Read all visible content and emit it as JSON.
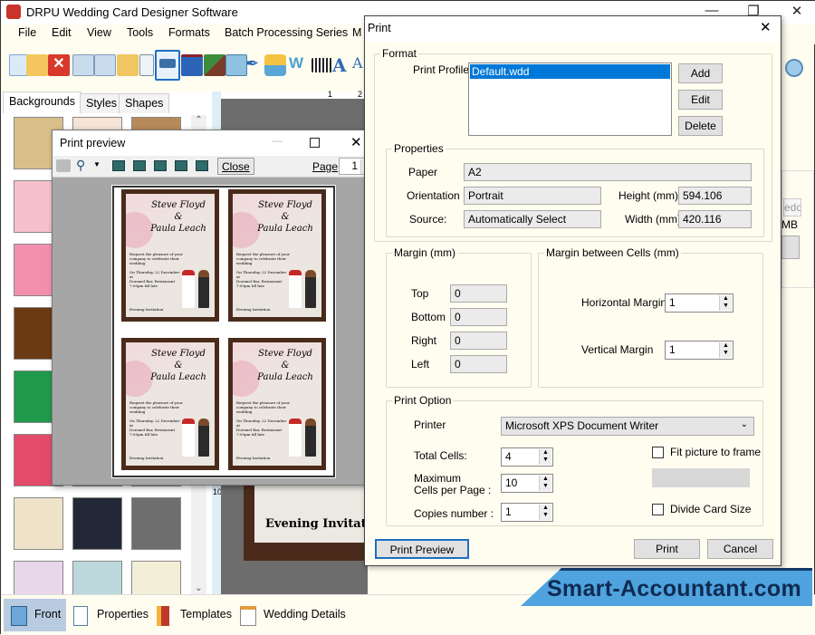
{
  "app": {
    "title": "DRPU Wedding Card Designer Software"
  },
  "menu": [
    "File",
    "Edit",
    "View",
    "Tools",
    "Formats",
    "Batch Processing Series",
    "M"
  ],
  "toolbar_icons": [
    "new-icon",
    "open-icon",
    "close-icon",
    "save-icon",
    "save-as-icon",
    "export-icon",
    "properties-icon",
    "print-icon",
    "layers-icon",
    "crop-icon",
    "insert-image-icon",
    "pen-icon",
    "shapes-icon",
    "wordart-icon",
    "barcode-icon",
    "text-icon",
    "text-frame-icon"
  ],
  "left_panel": {
    "tabs": [
      "Backgrounds",
      "Styles",
      "Shapes"
    ],
    "active_tab": "Backgrounds",
    "thumbnail_colors": [
      [
        "#d9c08a",
        "#f6e4d6",
        "#b88a5a"
      ],
      [
        "#f7c1cc",
        "#e7e2d8",
        "#d6d0c8"
      ],
      [
        "#f38fae",
        "#f0f0f0",
        "#d9c5ac"
      ],
      [
        "#6b3a12",
        "#e0d6c0",
        "#e6e6e6"
      ],
      [
        "#1f9a4a",
        "#e6e6e6",
        "#e6e6e6"
      ],
      [
        "#e44b6b",
        "#e6e6e6",
        "#e6e6e6"
      ],
      [
        "#eee3c8",
        "#232836",
        "#6e6e6e"
      ],
      [
        "#e8d7ea",
        "#bcd8dc",
        "#f3eed6"
      ]
    ]
  },
  "ruler": {
    "top_labels": [
      "1",
      "2"
    ],
    "left_label": "10"
  },
  "canvas": {
    "card_footer": "Evening Invitation"
  },
  "bottom_bar": {
    "buttons": [
      "Front",
      "Properties",
      "Templates",
      "Wedding Details"
    ],
    "active": "Front"
  },
  "print_preview": {
    "title": "Print preview",
    "close_label": "Close",
    "page_label": "Page",
    "page_value": "1",
    "cards": [
      {
        "name1": "Steve Floyd",
        "amp": "&",
        "name2": "Paula Leach",
        "msg": "Request the pleasure of your company to celebrate their wedding",
        "date": "On Thursday, 22 December",
        "at": "at",
        "venue": "Dorsmel Bar, Restaurant",
        "time": "7:00pm till late",
        "footer": "Evening Invitation"
      }
    ]
  },
  "print_dialog": {
    "title": "Print",
    "format": {
      "group_label": "Format",
      "profile_label": "Print Profile",
      "profiles": [
        "Default.wdd"
      ],
      "selected_profile": "Default.wdd",
      "add_label": "Add",
      "edit_label": "Edit",
      "delete_label": "Delete"
    },
    "properties": {
      "group_label": "Properties",
      "paper_label": "Paper",
      "paper": "A2",
      "orientation_label": "Orientation",
      "orientation": "Portrait",
      "source_label": "Source:",
      "source": "Automatically Select",
      "height_label": "Height (mm)",
      "height": "594.106",
      "width_label": "Width (mm)",
      "width": "420.116"
    },
    "margin": {
      "group_label": "Margin (mm)",
      "top_label": "Top",
      "top": "0",
      "bottom_label": "Bottom",
      "bottom": "0",
      "right_label": "Right",
      "right": "0",
      "left_label": "Left",
      "left": "0"
    },
    "cell_margin": {
      "group_label": "Margin between Cells (mm)",
      "horizontal_label": "Horizontal Margin",
      "horizontal": "1",
      "vertical_label": "Vertical Margin",
      "vertical": "1"
    },
    "print_option": {
      "group_label": "Print Option",
      "printer_label": "Printer",
      "printer": "Microsoft XPS Document Writer",
      "total_cells_label": "Total Cells:",
      "total_cells": "4",
      "max_cells_label_1": "Maximum",
      "max_cells_label_2": "Cells per Page :",
      "max_cells": "10",
      "copies_label": "Copies number :",
      "copies": "1",
      "fit_picture_label": "Fit picture to frame",
      "fit_picture_checked": false,
      "divide_card_label": "Divide Card Size",
      "divide_card_checked": false
    },
    "buttons": {
      "print_preview": "Print Preview",
      "print": "Print",
      "cancel": "Cancel"
    }
  },
  "background_partial": {
    "text1": "edc",
    "text2": "MB"
  },
  "watermark": "Smart-Accountant.com",
  "colors": {
    "dialog_bg": "#fffdf0",
    "selection": "#0078d7",
    "card_frame": "#4a2b1b",
    "banner": "#4fa3de"
  }
}
